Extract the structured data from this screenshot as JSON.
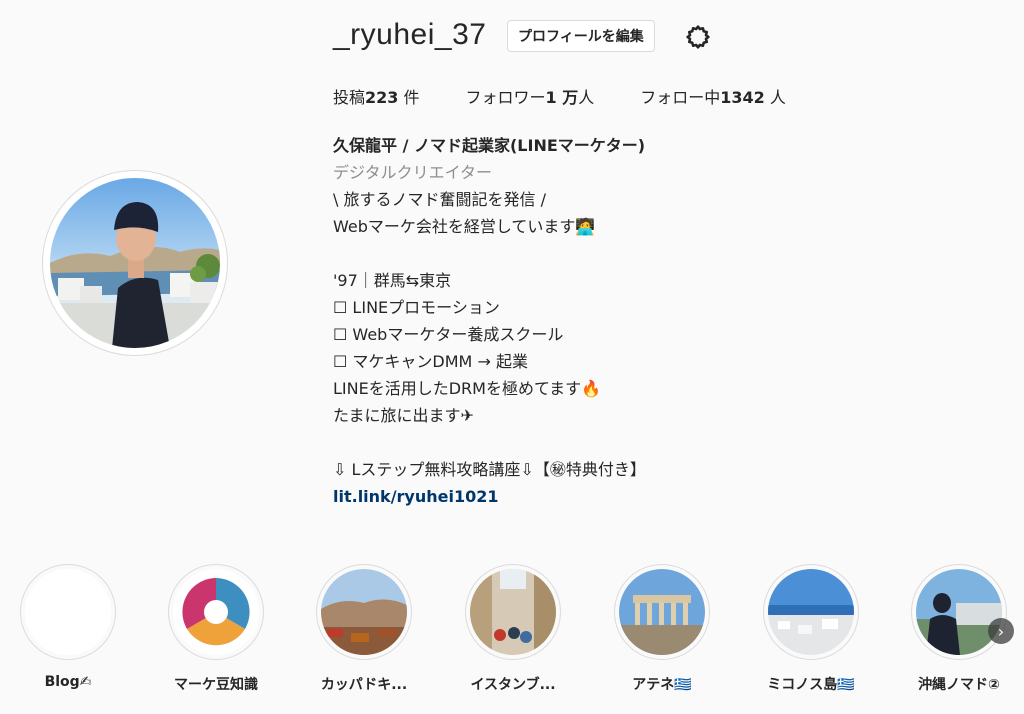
{
  "profile": {
    "username": "_ryuhei_37",
    "edit_label": "プロフィールを編集"
  },
  "stats": {
    "posts_prefix": "投稿",
    "posts_value": "223",
    "posts_suffix": " 件",
    "followers_prefix": "フォロワー",
    "followers_value": "1 万",
    "followers_suffix": "人",
    "following_prefix": "フォロー中",
    "following_value": "1342",
    "following_suffix": " 人"
  },
  "bio": {
    "name": "久保龍平 / ノマド起業家(LINEマーケター)",
    "category": "デジタルクリエイター",
    "lines": [
      "\\ 旅するノマド奮闘記を発信 /",
      "Webマーケ会社を経営しています🧑‍💻",
      "",
      "'97｜群馬⇆東京",
      "☐ LINEプロモーション",
      "☐ Webマーケター養成スクール",
      "☐ マケキャンDMM → 起業",
      "LINEを活用したDRMを極めてます🔥",
      "たまに旅に出ます✈",
      "",
      "⇩ Lステップ無料攻略講座⇩【㊙特典付き】"
    ],
    "link": "lit.link/ryuhei1021"
  },
  "highlights": [
    {
      "label": "Blog✍"
    },
    {
      "label": "マーケ豆知識"
    },
    {
      "label": "カッパドキ..."
    },
    {
      "label": "イスタンブ..."
    },
    {
      "label": "アテネ🇬🇷"
    },
    {
      "label": "ミコノス島🇬🇷"
    },
    {
      "label": "沖縄ノマド②"
    }
  ],
  "icons": {
    "gear": "gear-icon",
    "next": "chevron-right-icon"
  },
  "colors": {
    "link": "#00376b",
    "muted": "#8e8e8e",
    "border": "#dbdbdb"
  }
}
